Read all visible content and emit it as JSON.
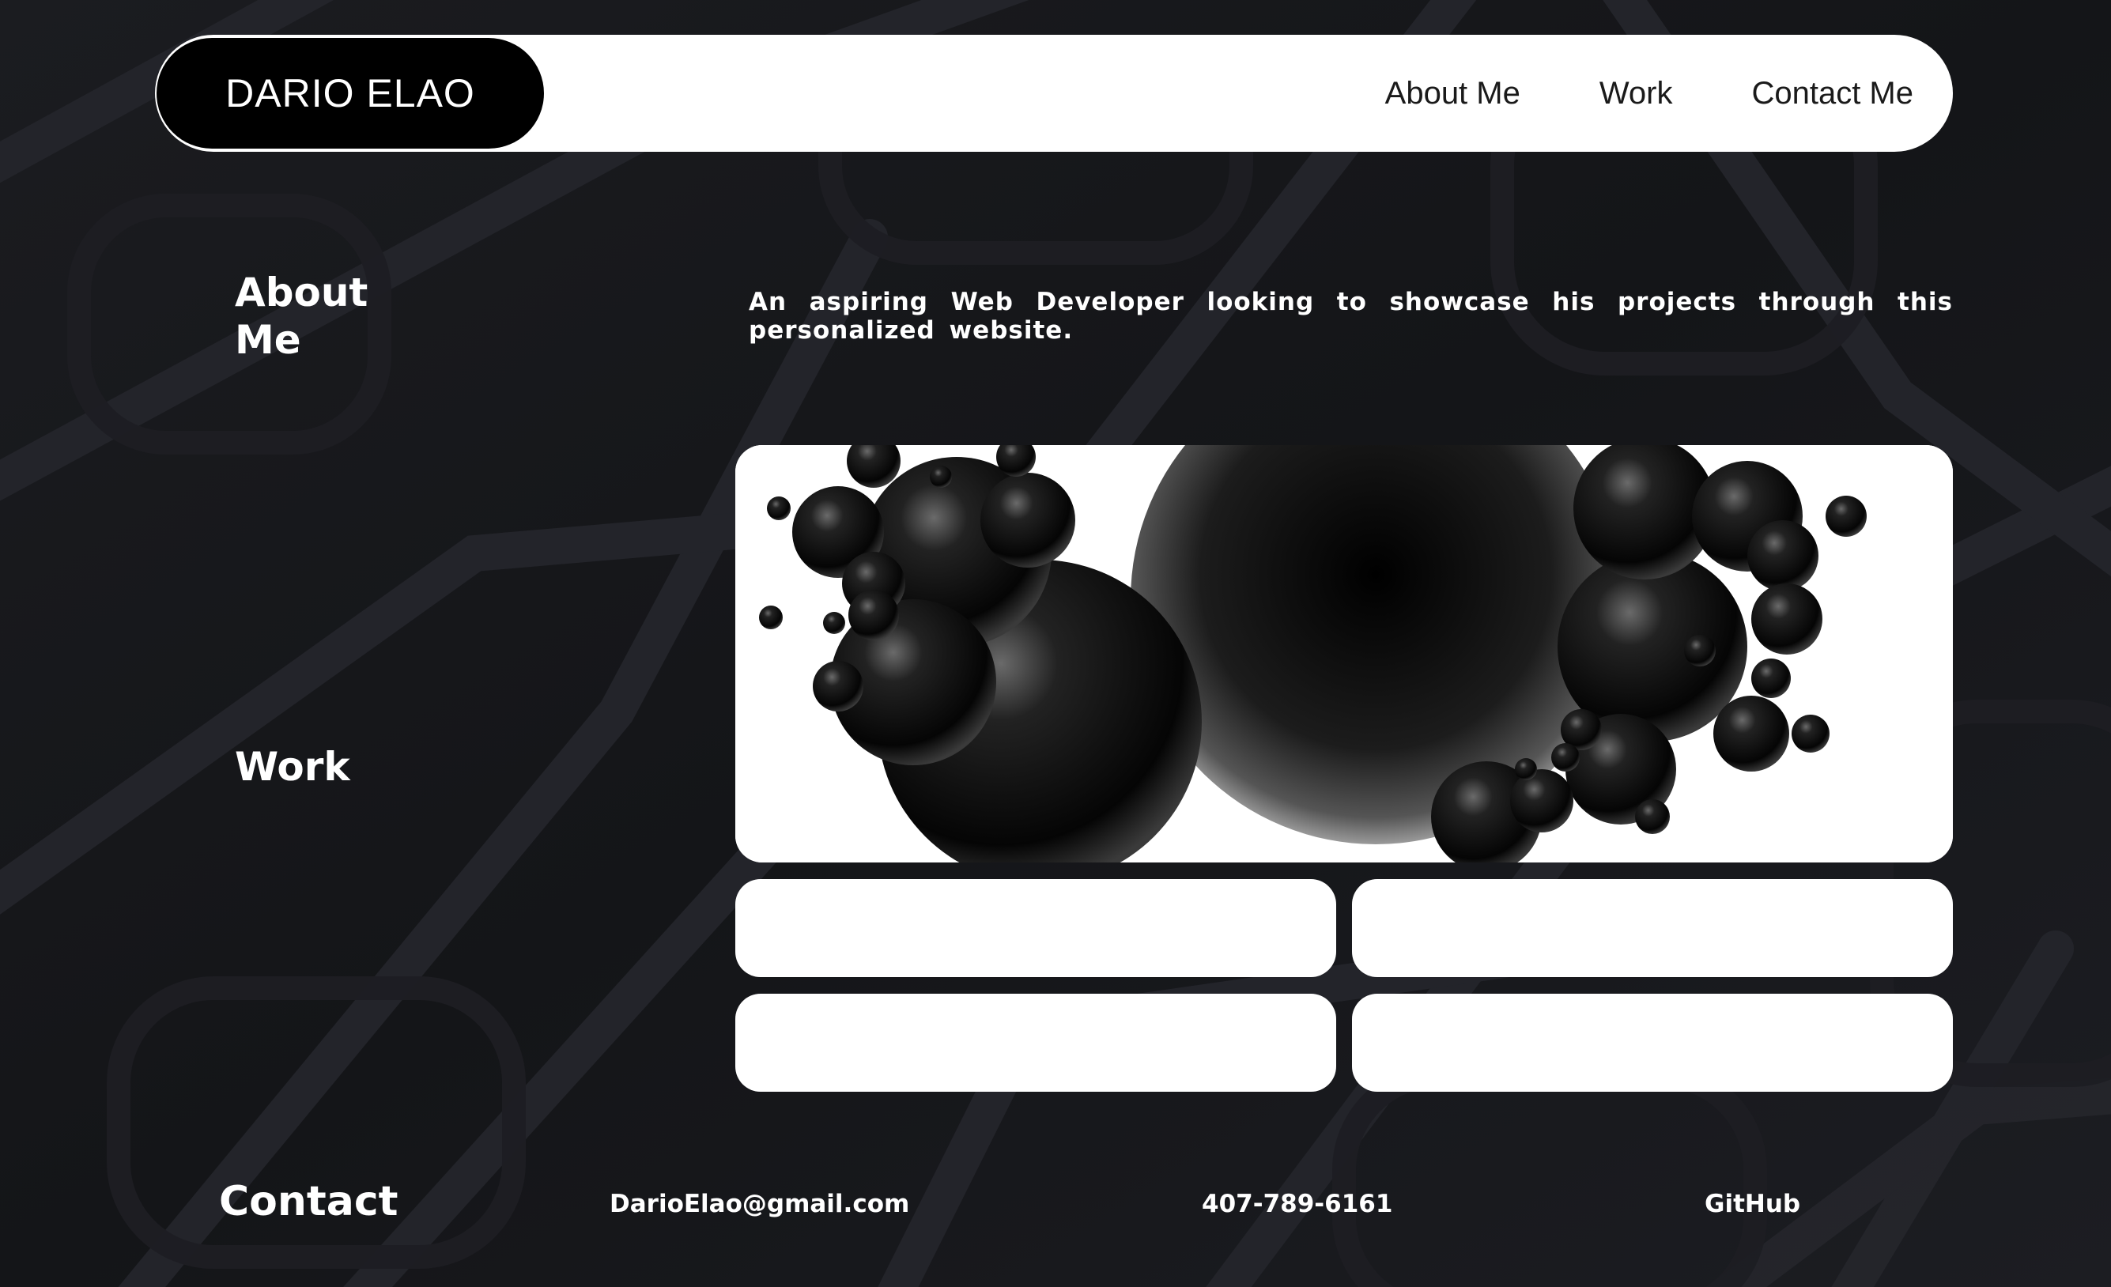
{
  "header": {
    "brand": "DARIO ELAO",
    "nav": [
      {
        "label": "About Me"
      },
      {
        "label": "Work"
      },
      {
        "label": "Contact Me"
      }
    ]
  },
  "about": {
    "heading": "About Me",
    "text": "An aspiring Web Developer looking to showcase his projects through this personalized website."
  },
  "work": {
    "heading": "Work",
    "hero_image": "abstract-black-spheres",
    "cards": [
      {},
      {},
      {},
      {}
    ]
  },
  "contact": {
    "heading": "Contact",
    "email": "DarioElao@gmail.com",
    "phone": "407-789-6161",
    "github": "GitHub"
  },
  "colors": {
    "background": "#16171b",
    "lattice": "#222328",
    "nav_bg": "#ffffff",
    "brand_bg": "#000000",
    "text_light": "#ffffff",
    "text_dark": "#1a1a1a"
  }
}
